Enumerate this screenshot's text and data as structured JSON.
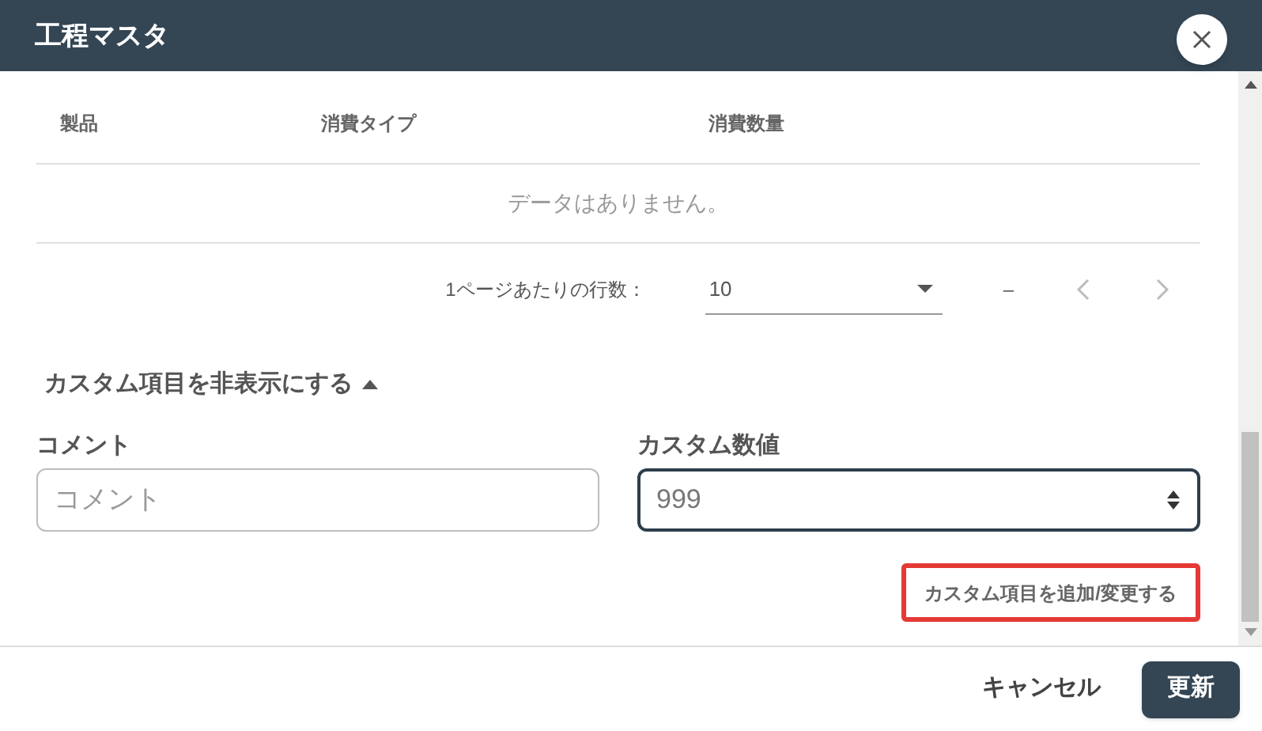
{
  "dialog": {
    "title": "工程マスタ"
  },
  "table": {
    "columns": [
      "製品",
      "消費タイプ",
      "消費数量"
    ],
    "empty_message": "データはありません。"
  },
  "pagination": {
    "rows_per_page_label": "1ページあたりの行数：",
    "rows_per_page": "10",
    "range": "–"
  },
  "custom_toggle": {
    "label": "カスタム項目を非表示にする",
    "expanded": true
  },
  "fields": [
    {
      "kind": "text",
      "label": "コメント",
      "placeholder": "コメント",
      "focused": false
    },
    {
      "kind": "number",
      "label": "カスタム数値",
      "value": "999",
      "focused": true
    }
  ],
  "add_custom_button": {
    "label": "カスタム項目を追加/変更する",
    "highlighted": true
  },
  "footer": {
    "cancel": "キャンセル",
    "submit": "更新"
  }
}
